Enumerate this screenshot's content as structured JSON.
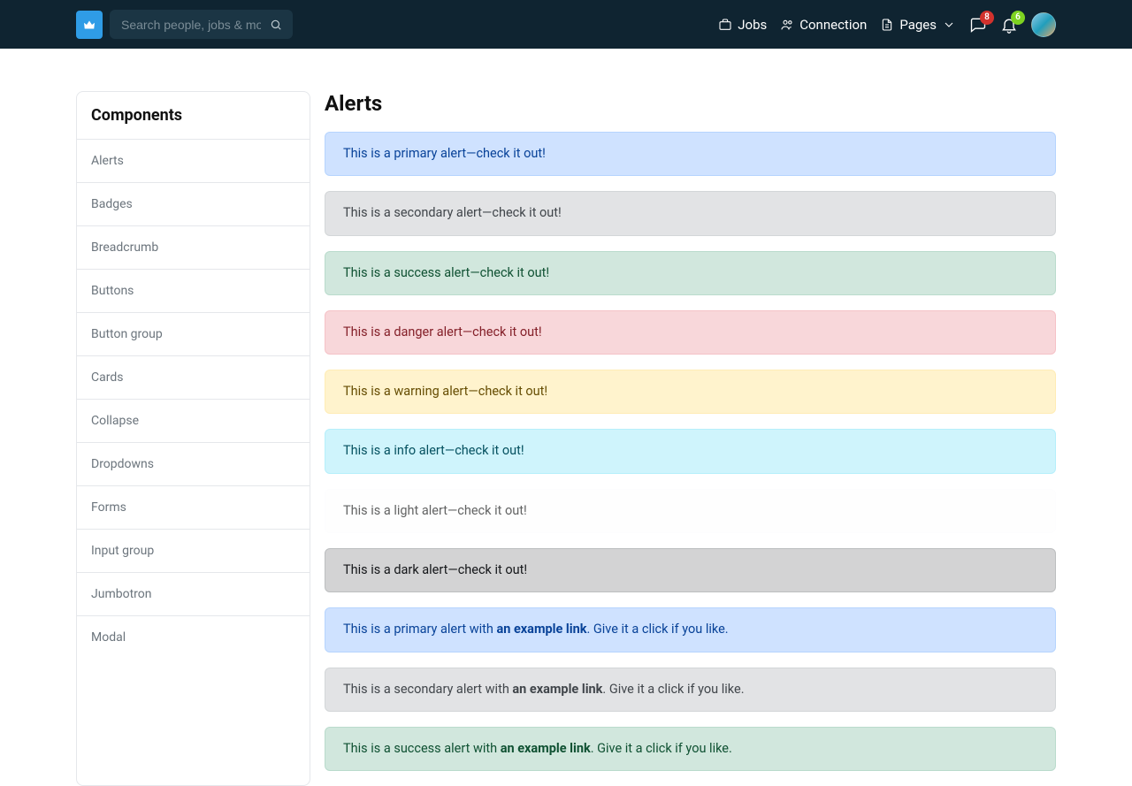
{
  "nav": {
    "search_placeholder": "Search people, jobs & more",
    "jobs": "Jobs",
    "connection": "Connection",
    "pages": "Pages",
    "messages_badge": "8",
    "notifications_badge": "6"
  },
  "sidebar": {
    "header": "Components",
    "items": [
      "Alerts",
      "Badges",
      "Breadcrumb",
      "Buttons",
      "Button group",
      "Cards",
      "Collapse",
      "Dropdowns",
      "Forms",
      "Input group",
      "Jumbotron",
      "Modal"
    ]
  },
  "main": {
    "title": "Alerts"
  },
  "alerts": {
    "primary": "This is a primary alert—check it out!",
    "secondary": "This is a secondary alert—check it out!",
    "success": "This is a success alert—check it out!",
    "danger": "This is a danger alert—check it out!",
    "warning": "This is a warning alert—check it out!",
    "info": "This is a info alert—check it out!",
    "light": "This is a light alert—check it out!",
    "dark": "This is a dark alert—check it out!"
  },
  "link_alerts": {
    "primary_before": "This is a primary alert with ",
    "primary_link": "an example link",
    "primary_after": ". Give it a click if you like.",
    "secondary_before": "This is a secondary alert with ",
    "secondary_link": "an example link",
    "secondary_after": ". Give it a click if you like.",
    "success_before": "This is a success alert with ",
    "success_link": "an example link",
    "success_after": ". Give it a click if you like."
  }
}
